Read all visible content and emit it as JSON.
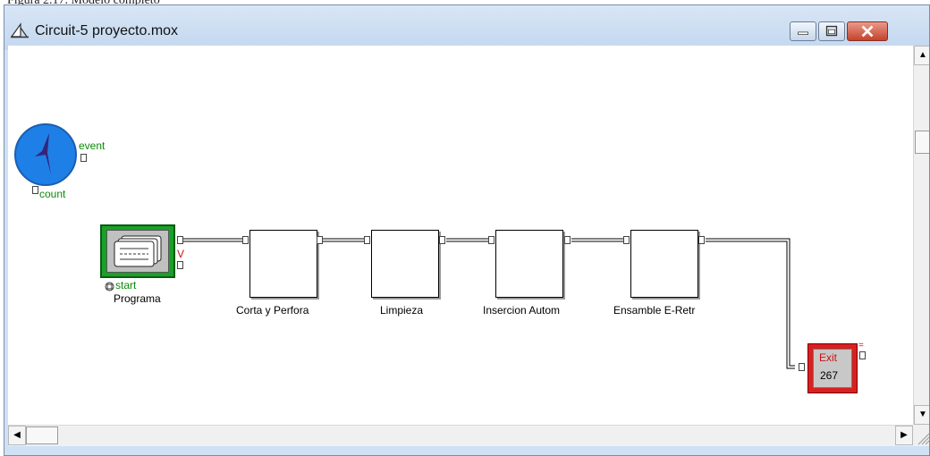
{
  "caption": "Figura 2.17. Modelo completo",
  "window": {
    "title": "Circuit-5 proyecto.mox",
    "controls": [
      "minimize",
      "maximize",
      "close"
    ]
  },
  "timer": {
    "event_label": "event",
    "count_label": "count",
    "icon": "clock-icon"
  },
  "program": {
    "label": "Programa",
    "start_label": "start",
    "v_label": "V",
    "icon": "paper-stack-icon"
  },
  "activities": [
    {
      "label": "Corta y Perfora"
    },
    {
      "label": "Limpieza"
    },
    {
      "label": "Insercion Autom"
    },
    {
      "label": "Ensamble E-Retr"
    }
  ],
  "exit": {
    "label": "Exit",
    "count": "267"
  },
  "colors": {
    "accent_green": "#0a8a0a",
    "exit_red": "#d92020",
    "timer_blue": "#1e7fe6"
  }
}
